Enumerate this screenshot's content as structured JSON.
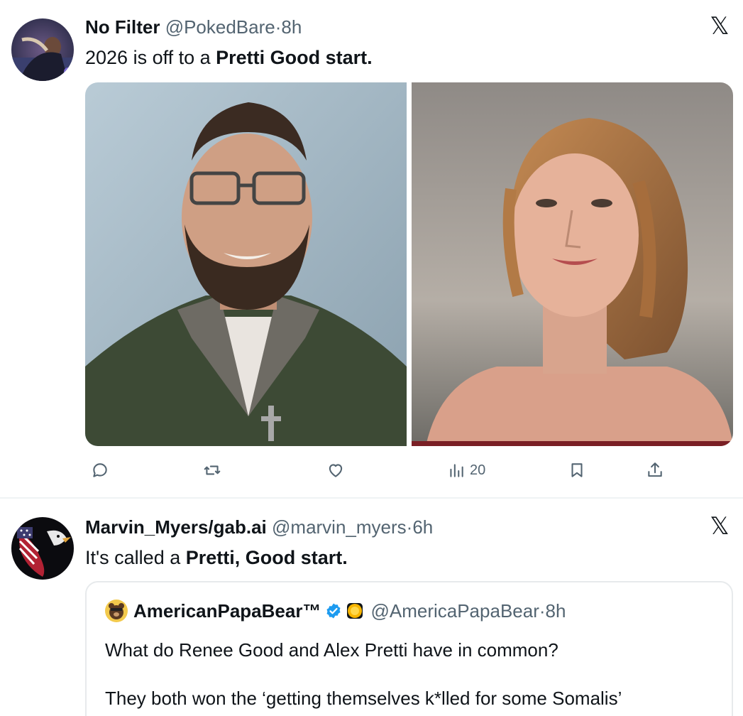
{
  "tweet1": {
    "name": "No Filter",
    "handle": "@PokedBare",
    "separator": "·",
    "time": "8h",
    "text_before": "2026 is off to a ",
    "text_bold": "Pretti Good start.",
    "close_icon": "x-logo-icon",
    "close_glyph": "𝕏",
    "actions": {
      "reply_icon": "reply-icon",
      "retweet_icon": "retweet-icon",
      "like_icon": "like-icon",
      "views_icon": "views-icon",
      "views_count": "20",
      "bookmark_icon": "bookmark-icon",
      "share_icon": "share-icon"
    }
  },
  "tweet2": {
    "name": "Marvin_Myers/gab.ai",
    "handle": "@marvin_myers",
    "separator": "·",
    "time": "6h",
    "text_before": "It's called a ",
    "text_bold": "Pretti, Good start.",
    "close_icon": "x-logo-icon",
    "close_glyph": "𝕏",
    "quote": {
      "name": "AmericanPapaBear™",
      "handle": "@AmericaPapaBear",
      "separator": "·",
      "time": "8h",
      "line1": "What do Renee Good and Alex Pretti have in common?",
      "line2": "They both won the ‘getting themselves k*lled for some Somalis’"
    }
  },
  "colors": {
    "text_primary": "#0f1419",
    "text_secondary": "#536471",
    "verified_blue": "#1d9bf0",
    "divider": "#eff3f4"
  }
}
